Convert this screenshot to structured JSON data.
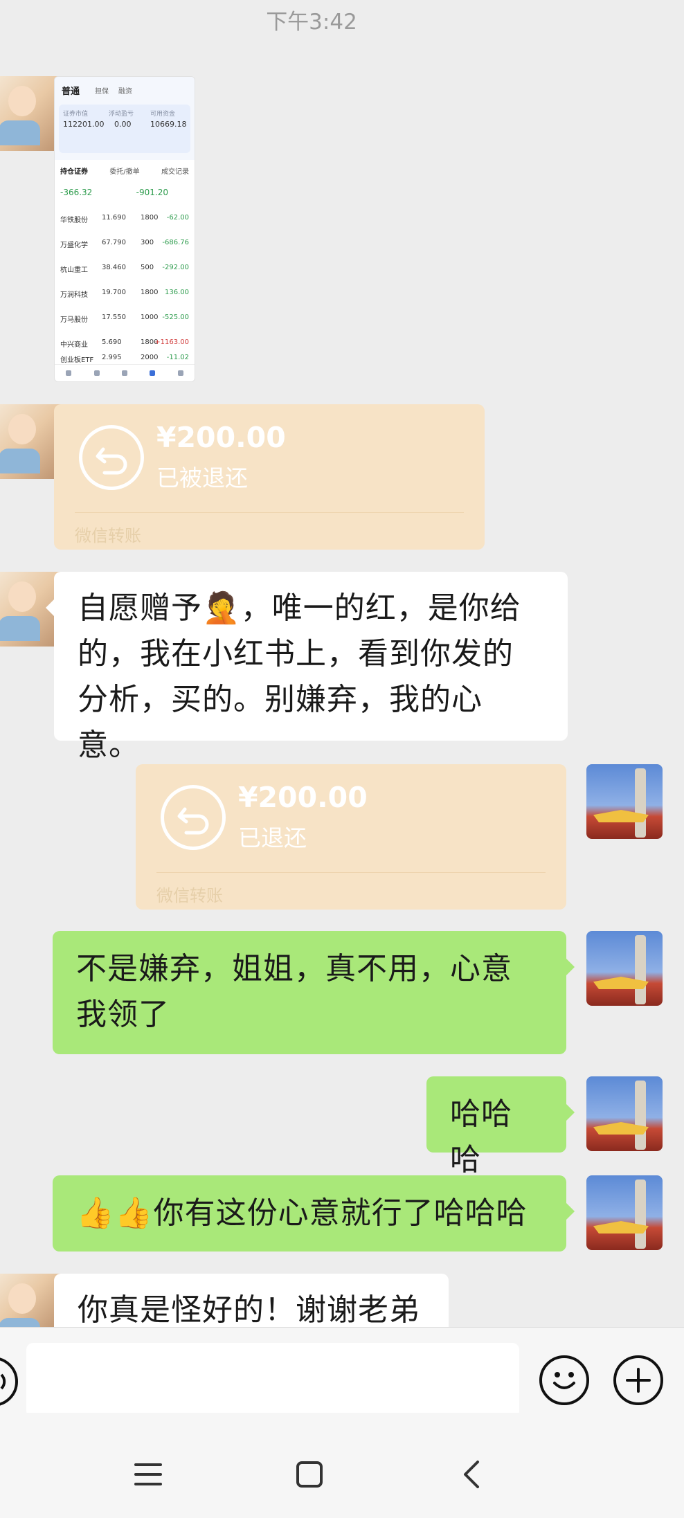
{
  "status_bar": {
    "time": "下午3:42"
  },
  "contact_avatar_icon": "girl-avatar-icon",
  "my_avatar_icon": "tiananmen-avatar-icon",
  "screenshot_thumb": {
    "app_title": "普通",
    "tab2": "担保",
    "tab3": "融资",
    "account_labels": [
      "证券市值",
      "浮动盈亏",
      "可用资金"
    ],
    "account_values": [
      "112201.00",
      "0.00",
      "10669.18"
    ],
    "tabs": [
      "持仓证券",
      "委托/撤单",
      "成交记录"
    ],
    "summary": [
      "-366.32",
      "-901.20"
    ],
    "rows": [
      {
        "name": "华铁股份",
        "price": "11.690",
        "qty": "1800",
        "pl": "-62.00"
      },
      {
        "name": "万盛化学",
        "price": "67.790",
        "qty": "300",
        "pl": "-686.76"
      },
      {
        "name": "杭山重工",
        "price": "38.460",
        "qty": "500",
        "pl": "-292.00"
      },
      {
        "name": "万润科技",
        "price": "19.700",
        "qty": "1800",
        "pl": "136.00"
      },
      {
        "name": "万马股份",
        "price": "17.550",
        "qty": "1000",
        "pl": "-525.00"
      },
      {
        "name": "中兴商业",
        "price": "5.690",
        "qty": "1800",
        "pl": "+1163.00"
      },
      {
        "name": "创业板ETF",
        "price": "2.995",
        "qty": "2000",
        "pl": "-11.02"
      }
    ]
  },
  "transfer1": {
    "amount": "¥200.00",
    "status": "已被退还",
    "footer": "微信转账"
  },
  "msg_contact_1": "自愿赠予🤦，唯一的红，是你给的，我在小红书上，看到你发的分析，买的。别嫌弃，我的心意。",
  "transfer2": {
    "amount": "¥200.00",
    "status": "已退还",
    "footer": "微信转账"
  },
  "msg_me_1": "不是嫌弃，姐姐，真不用，心意我领了",
  "msg_me_2": "哈哈哈",
  "msg_me_3": "👍👍你有这份心意就行了哈哈哈",
  "msg_contact_2": "你真是怪好的！谢谢老弟",
  "input_bar": {
    "voice_icon": "voice-icon",
    "emoji_icon": "emoji-icon",
    "more_icon": "plus-icon"
  },
  "nav_bar": {
    "menu_icon": "menu-icon",
    "home_icon": "home-icon",
    "back_icon": "back-icon"
  },
  "colors": {
    "green_bubble": "#a9e879",
    "transfer_bg": "#f7e3c6",
    "background": "#ededed"
  }
}
